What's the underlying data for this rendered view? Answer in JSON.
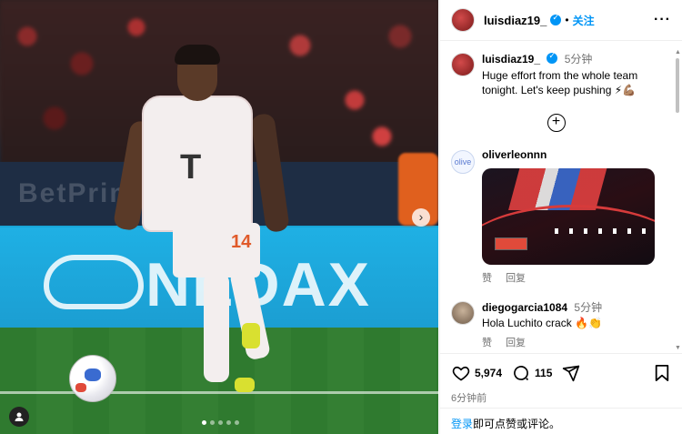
{
  "media": {
    "jersey_number": "14",
    "carousel_dots": 5,
    "active_dot": 0,
    "next_icon": "chevron-right-icon",
    "tag_icon": "user-tag-icon"
  },
  "header": {
    "username": "luisdiaz19_",
    "separator": "•",
    "follow_label": "关注",
    "more_label": "···"
  },
  "caption": {
    "username": "luisdiaz19_",
    "time": "5分钟",
    "text": "Huge effort from the whole team tonight. Let's keep pushing ⚡💪🏽"
  },
  "comments": [
    {
      "username": "oliverleonnn",
      "avatar_text": "olive",
      "has_image": true,
      "like_label": "赞",
      "reply_label": "回复"
    },
    {
      "username": "diegogarcia1084",
      "time": "5分钟",
      "text": "Hola Luchito crack 🔥👏",
      "like_label": "赞",
      "reply_label": "回复"
    }
  ],
  "footer": {
    "likes": "5,974",
    "comments_count": "115",
    "posted_time": "6分钟前",
    "login_link": "登录",
    "login_rest": "即可点赞或评论。"
  },
  "colors": {
    "accent": "#0095f6",
    "muted": "#737373"
  }
}
